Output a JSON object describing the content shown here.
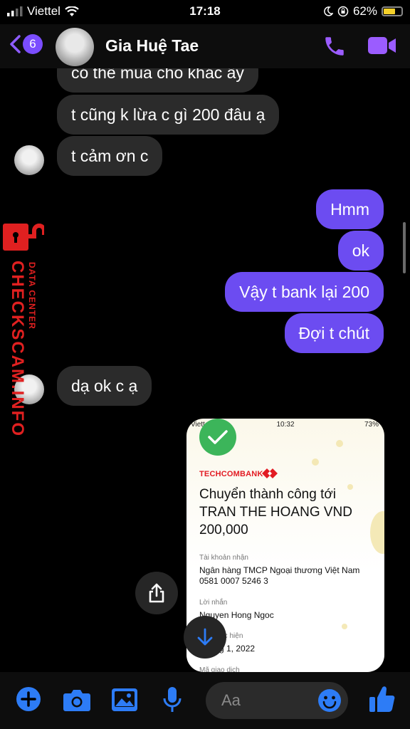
{
  "status_bar": {
    "carrier": "Viettel",
    "time": "17:18",
    "battery": "62%"
  },
  "header": {
    "back_count": "6",
    "contact_name": "Gia Huệ Tae"
  },
  "messages": {
    "m0": "có thể mua cho khác ấy",
    "m1": "t cũng k lừa c gì 200 đâu ạ",
    "m2": "t cảm ơn c",
    "m3": "Hmm",
    "m4": "ok",
    "m5": "Vậy t bank lại 200",
    "m6": "Đợi t chút",
    "m7": "dạ ok c ạ"
  },
  "watermark": {
    "brand": "CHECKSCAM.INFO",
    "tagline": "DATA CENTER"
  },
  "receipt": {
    "carrier": "Viettel",
    "time": "10:32",
    "battery": "73%",
    "bank": "TECHCOMBANK",
    "title": "Chuyển thành công tới TRAN THE HOANG VND 200,000",
    "receiver_label": "Tài khoản nhận",
    "receiver_bank": "Ngân hàng TMCP Ngoại thương Việt Nam",
    "receiver_account": "0581 0007 5246 3",
    "message_label": "Lời nhắn",
    "message_value": "Nguyen Hong Ngoc",
    "date_label": "ực hiện",
    "date_value": "g 1, 2022",
    "txn_label": "Mã giao dịch"
  },
  "composer": {
    "placeholder": "Aa"
  },
  "colors": {
    "outgoing": "#6c4cf1",
    "incoming": "#2b2b2b",
    "accent": "#7b4dff",
    "icon_blue": "#2d7cf6"
  },
  "icons": [
    "back-chevron-icon",
    "phone-icon",
    "video-camera-icon",
    "share-icon",
    "arrow-down-icon",
    "plus-icon",
    "camera-icon",
    "gallery-icon",
    "microphone-icon",
    "emoji-icon",
    "thumbs-up-icon"
  ]
}
